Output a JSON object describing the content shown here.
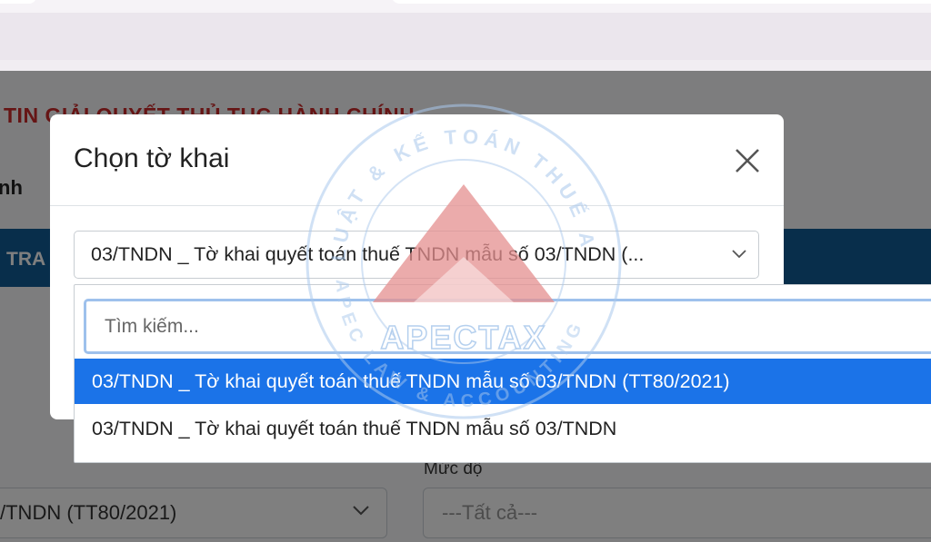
{
  "page": {
    "heading": "TIN GIẢI QUYẾT THỦ TỤC HÀNH CHÍNH",
    "subheading": "nh",
    "navbar_label": "TRA",
    "muc_do_label": "Mức độ",
    "select_left_value": "/TNDN (TT80/2021)",
    "select_right_placeholder": "---Tất cả---"
  },
  "modal": {
    "title": "Chọn tờ khai",
    "selected_value": "03/TNDN _ Tờ khai quyết toán thuế TNDN mẫu số 03/TNDN (...",
    "search_placeholder": "Tìm kiếm...",
    "options": [
      {
        "label": "03/TNDN _ Tờ khai quyết toán thuế TNDN mẫu số 03/TNDN (TT80/2021)",
        "highlighted": true
      },
      {
        "label": "03/TNDN _ Tờ khai quyết toán thuế TNDN mẫu số 03/TNDN",
        "highlighted": false
      }
    ]
  },
  "watermark": {
    "brand": "APECTAX",
    "ring_top": "LUẬT & KẾ TOÁN THUẾ APEC",
    "ring_bottom": "APEC LAW & ACCOUNTING"
  },
  "colors": {
    "accent": "#1b73e8",
    "navbar": "#115d96",
    "heading_red": "#cc2a2a",
    "focus_ring": "#9ec1ec"
  },
  "icons": {
    "close": "close-icon",
    "chevron": "chevron-down-icon"
  }
}
